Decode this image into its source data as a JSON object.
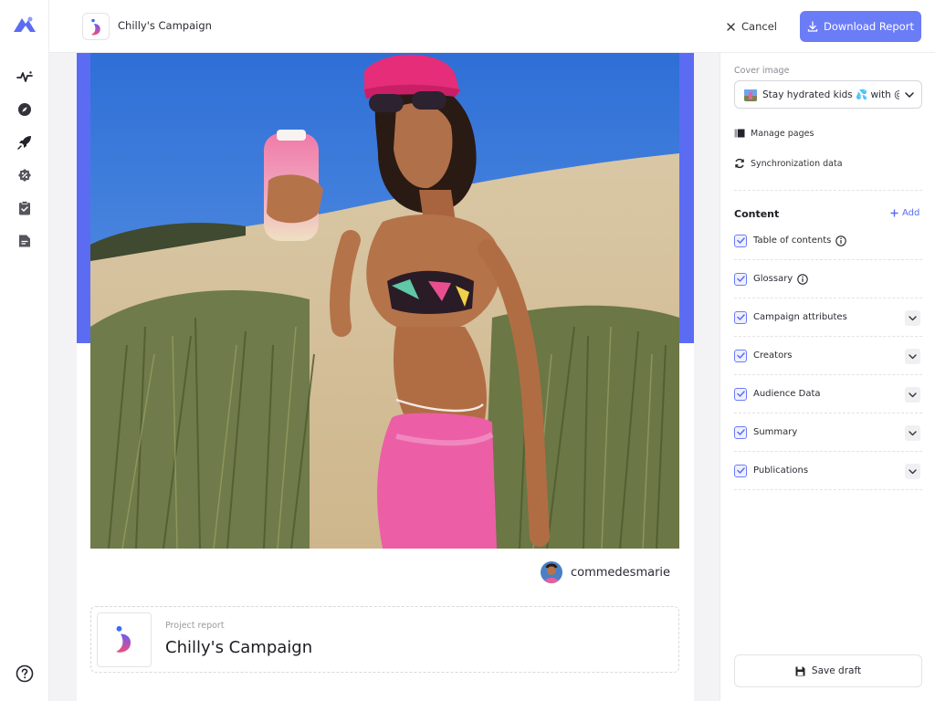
{
  "app": {
    "logo_icon": "brand-mountain-icon"
  },
  "rail": {
    "items": [
      {
        "icon": "activity-icon"
      },
      {
        "icon": "compass-icon"
      },
      {
        "icon": "rocket-icon"
      },
      {
        "icon": "percent-badge-icon"
      },
      {
        "icon": "clipboard-check-icon"
      },
      {
        "icon": "document-icon"
      }
    ],
    "help_icon": "help-circle-icon"
  },
  "topbar": {
    "campaign_title": "Chilly's Campaign",
    "cancel_label": "Cancel",
    "download_label": "Download Report"
  },
  "preview": {
    "creator_handle": "commedesmarie",
    "report_kicker": "Project report",
    "report_title": "Chilly's Campaign"
  },
  "panel": {
    "cover_label": "Cover image",
    "cover_value": "Stay hydrated kids 💦 with @c...",
    "manage_pages": "Manage pages",
    "sync_data": "Synchronization data",
    "content_heading": "Content",
    "add_label": "Add",
    "items": [
      {
        "label": "Table of contents",
        "checked": true,
        "info": true,
        "expandable": false
      },
      {
        "label": "Glossary",
        "checked": true,
        "info": true,
        "expandable": false
      },
      {
        "label": "Campaign attributes",
        "checked": true,
        "info": false,
        "expandable": true
      },
      {
        "label": "Creators",
        "checked": true,
        "info": false,
        "expandable": true
      },
      {
        "label": "Audience Data",
        "checked": true,
        "info": false,
        "expandable": true
      },
      {
        "label": "Summary",
        "checked": true,
        "info": false,
        "expandable": true
      },
      {
        "label": "Publications",
        "checked": true,
        "info": false,
        "expandable": true
      }
    ],
    "save_draft": "Save draft"
  },
  "colors": {
    "accent": "#6b7cf7",
    "band": "#5b6cf3"
  }
}
